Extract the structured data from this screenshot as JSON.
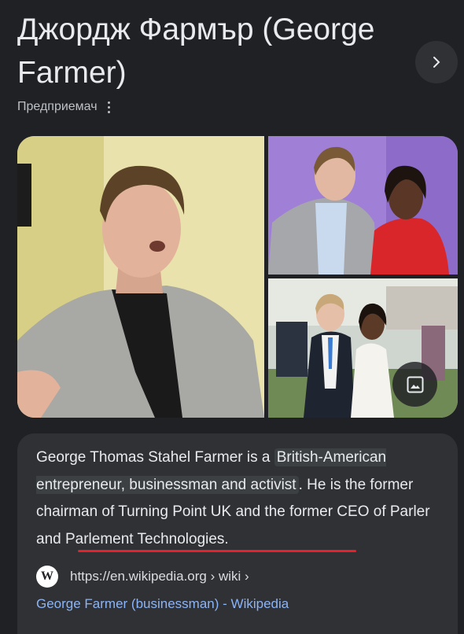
{
  "header": {
    "title": "Джордж Фармър (George Farmer)",
    "subtitle": "Предприемач"
  },
  "icons": {
    "next": "chevron-right-icon",
    "more": "more-vert-icon",
    "images": "image-icon",
    "source": "wikipedia-icon"
  },
  "description": {
    "part1": "George Thomas Stahel Farmer is a ",
    "highlight": "British-American entrepreneur, businessman and activist",
    "part2": ". He is the former chairman of Turning Point UK and the former CEO of Parler and Parlement Technologies."
  },
  "source": {
    "badge": "W",
    "url": "https://en.wikipedia.org › wiki ›",
    "link_text": "George Farmer (businessman) - Wikipedia"
  },
  "colors": {
    "background": "#202124",
    "card": "#303134",
    "link": "#8ab4f8",
    "underline": "#e8202a"
  }
}
